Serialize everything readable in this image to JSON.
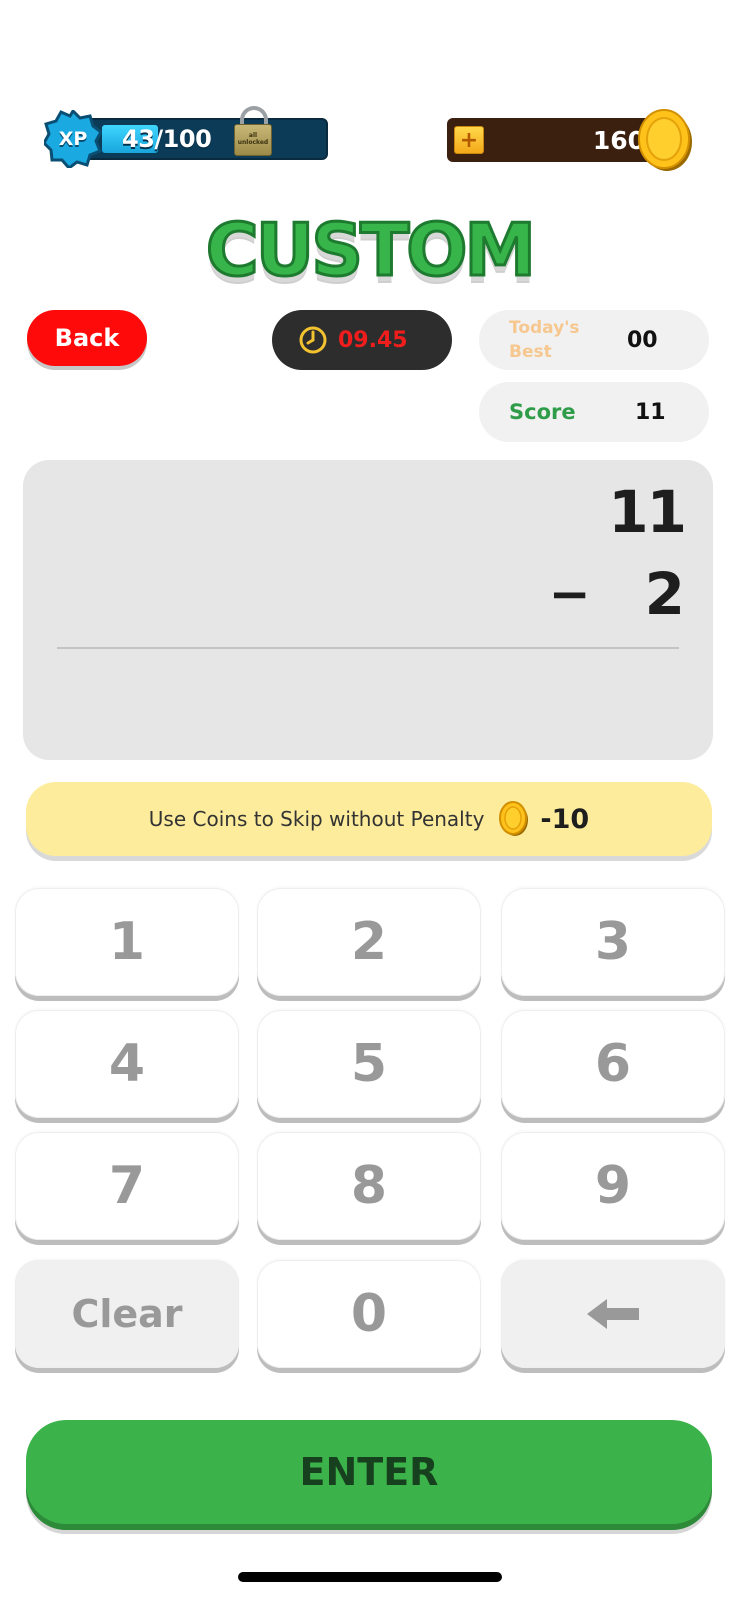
{
  "header": {
    "xp": {
      "badge": "XP",
      "current": "43",
      "max": "100",
      "text": "43/100",
      "progress": 0.43,
      "lock_text": "all unlocked"
    },
    "coins": {
      "plus": "+",
      "count": "160"
    }
  },
  "title": "CUSTOM",
  "back_label": "Back",
  "timer": {
    "value": "09.45",
    "icon": "clock-icon"
  },
  "best": {
    "label": "Today's Best",
    "value": "00"
  },
  "score": {
    "label": "Score",
    "value": "11"
  },
  "problem": {
    "operand1": "11",
    "operator": "−",
    "operand2": "2",
    "answer": ""
  },
  "skip": {
    "text": "Use Coins to Skip without Penalty",
    "cost": "-10",
    "icon": "coin-icon"
  },
  "keypad": {
    "k1": "1",
    "k2": "2",
    "k3": "3",
    "k4": "4",
    "k5": "5",
    "k6": "6",
    "k7": "7",
    "k8": "8",
    "k9": "9",
    "clear": "Clear",
    "k0": "0",
    "backspace_icon": "left-arrow-icon"
  },
  "enter_label": "ENTER",
  "colors": {
    "accent_green": "#3cb34a",
    "back_red": "#ff0a0a",
    "timer_red": "#f01d1d",
    "skip_yellow": "#fcec9c"
  }
}
